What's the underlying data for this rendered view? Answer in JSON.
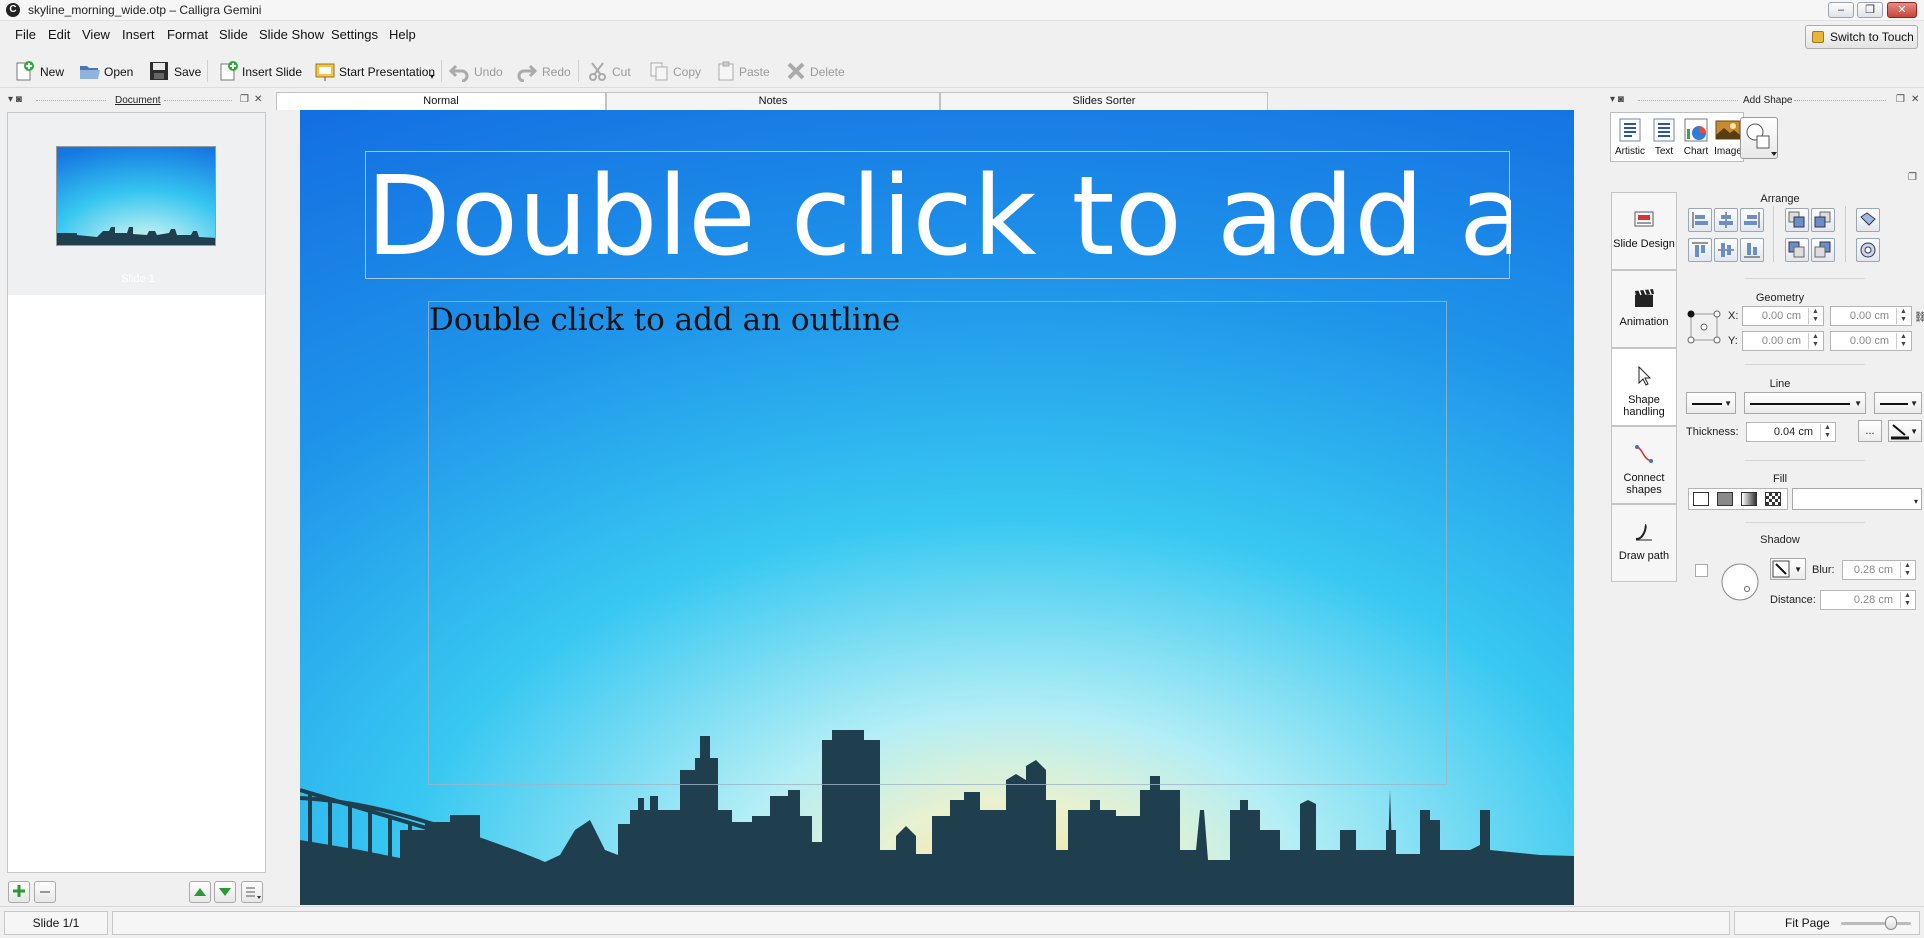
{
  "window": {
    "title": "skyline_morning_wide.otp – Calligra Gemini",
    "logo_letter": "C",
    "controls": [
      "minimize",
      "maximize",
      "close"
    ]
  },
  "menu": [
    "File",
    "Edit",
    "View",
    "Insert",
    "Format",
    "Slide",
    "Slide Show",
    "Settings",
    "Help"
  ],
  "switch_to_touch": "Switch to Touch",
  "toolbar": {
    "new": "New",
    "open": "Open",
    "save": "Save",
    "insert_slide": "Insert Slide",
    "start_presentation": "Start Presentation",
    "undo": "Undo",
    "redo": "Redo",
    "cut": "Cut",
    "copy": "Copy",
    "paste": "Paste",
    "delete": "Delete"
  },
  "left_dock": {
    "title": "Document",
    "slides": [
      {
        "label": "Slide 1"
      }
    ]
  },
  "view_tabs": {
    "normal": "Normal",
    "notes": "Notes",
    "slides_sorter": "Slides Sorter"
  },
  "slide": {
    "title_placeholder": "Double click to add a",
    "outline_placeholder": "Double click to add an outline"
  },
  "right_dock": {
    "title": "Add Shape",
    "shape_tools": {
      "artistic": "Artistic",
      "text": "Text",
      "chart": "Chart",
      "image": "Image"
    },
    "side_tabs": {
      "slide_design": "Slide Design",
      "animation": "Animation",
      "shape_handling_1": "Shape",
      "shape_handling_2": "handling",
      "connect_shapes_1": "Connect",
      "connect_shapes_2": "shapes",
      "draw_path": "Draw path"
    },
    "arrange_title": "Arrange",
    "geometry": {
      "title": "Geometry",
      "x_label": "X:",
      "y_label": "Y:",
      "x_value": "0.00 cm",
      "y_value": "0.00 cm",
      "w_value": "0.00 cm",
      "h_value": "0.00 cm"
    },
    "line": {
      "title": "Line",
      "thickness_label": "Thickness:",
      "thickness_value": "0.04 cm",
      "more": "..."
    },
    "fill_title": "Fill",
    "shadow": {
      "title": "Shadow",
      "blur_label": "Blur:",
      "blur_value": "0.28 cm",
      "distance_label": "Distance:",
      "distance_value": "0.28 cm"
    }
  },
  "status": {
    "slide_counter": "Slide 1/1",
    "zoom_label": "Fit Page"
  },
  "colors": {
    "sky_top": "#1a7fe6",
    "sky_mid": "#33c9f1",
    "horizon": "#eedd9a",
    "skyline": "#1f3f4e"
  }
}
